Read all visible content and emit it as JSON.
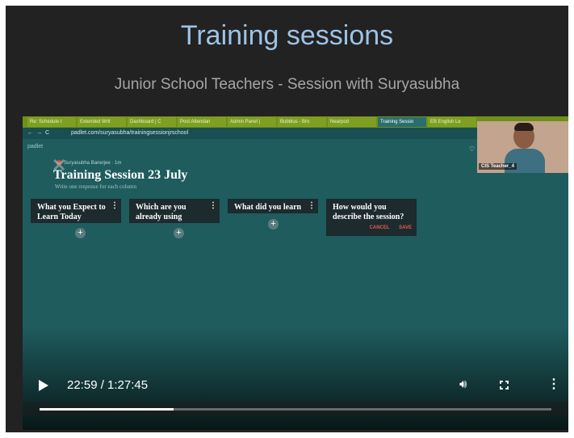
{
  "slide": {
    "title": "Training sessions",
    "subtitle": "Junior School Teachers - Session with Suryasubha"
  },
  "browser": {
    "tabs": [
      "Re: Schedule t",
      "Extended Writ",
      "Dashboard | C",
      "Post Attendan",
      "Admin Panel |",
      "Bubblus - Bro",
      "Nearpod",
      "Training Sessio",
      "EB English Le"
    ],
    "active_tab_index": 7,
    "url": "padlet.com/suryasubha/trainingsessionjrschool"
  },
  "padlet": {
    "brand": "padlet",
    "author": "Suryasubha Banerjee · 1m",
    "title": "Training Session 23 July",
    "description": "Write one response for each column",
    "columns": [
      {
        "title": "What you Expect to Learn Today"
      },
      {
        "title": "Which are you already using"
      },
      {
        "title": "What did you learn"
      },
      {
        "title": "How would you describe the session?",
        "cancel": "CANCEL",
        "save": "SAVE"
      }
    ]
  },
  "webcam": {
    "name": "CIS Teacher_4"
  },
  "player": {
    "timecode": "22:59 / 1:27:45",
    "progress_fraction": 0.262
  },
  "icons": [
    "play-icon",
    "volume-icon",
    "fullscreen-icon",
    "more-vertical-icon",
    "plus-icon",
    "heart-icon"
  ]
}
